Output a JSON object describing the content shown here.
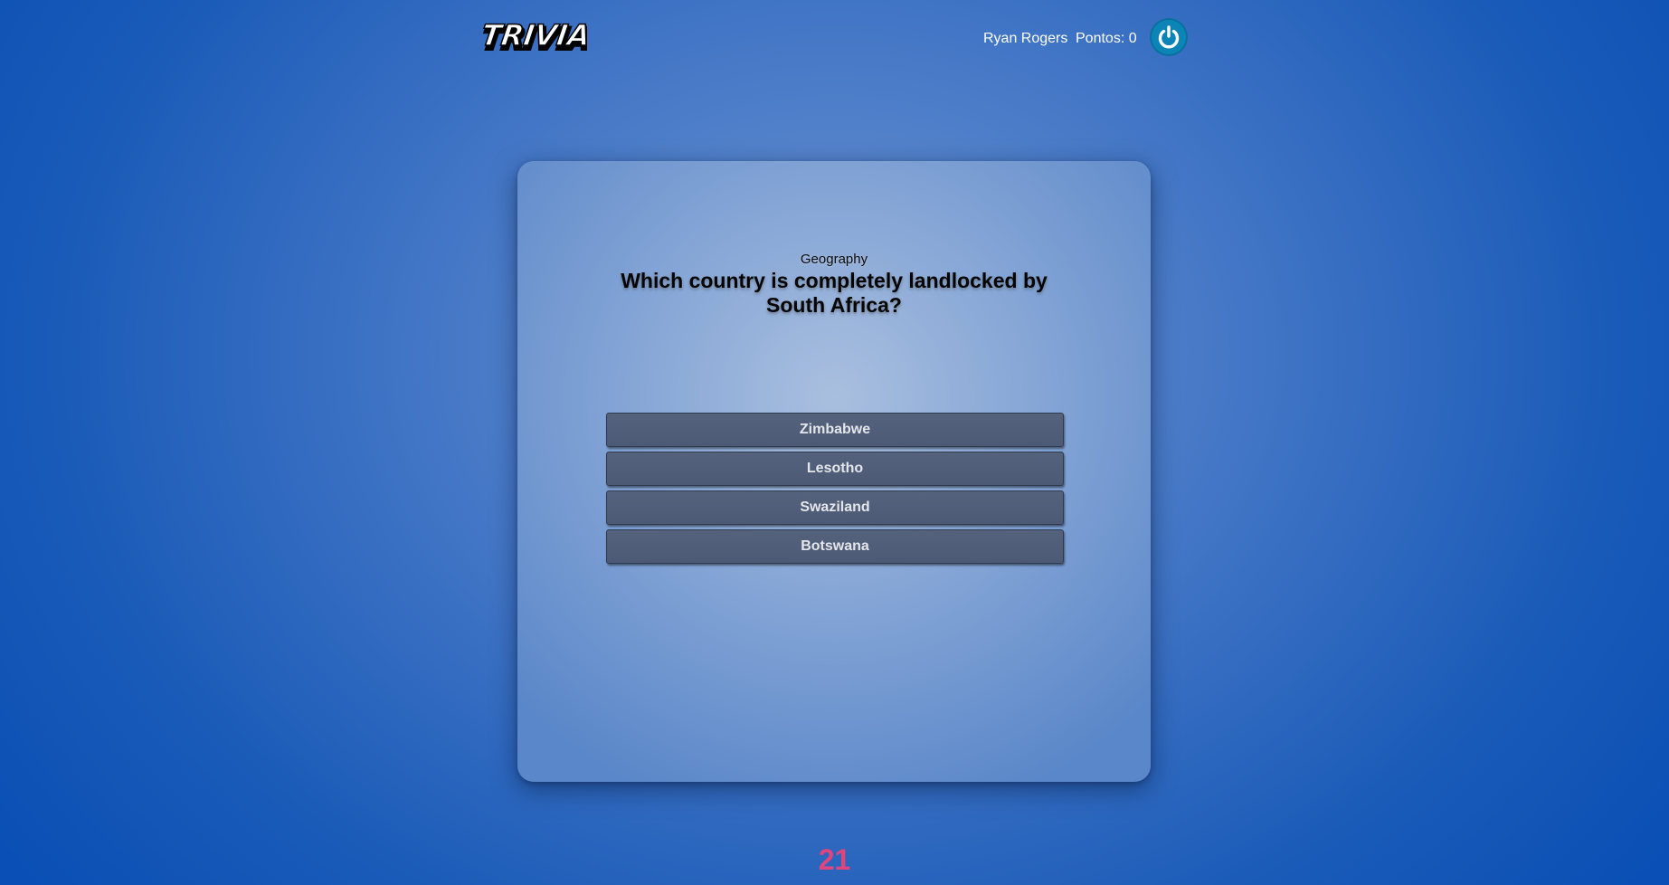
{
  "header": {
    "logo_text": "TRIVIA",
    "user_name": "Ryan Rogers",
    "score_label": "Pontos: 0",
    "logout_icon": "power-icon"
  },
  "game": {
    "category": "Geography",
    "question": "Which country is completely landlocked by South Africa?",
    "answers": [
      {
        "label": "Zimbabwe"
      },
      {
        "label": "Lesotho"
      },
      {
        "label": "Swaziland"
      },
      {
        "label": "Botswana"
      }
    ],
    "timer": "21"
  },
  "colors": {
    "background": "#1a5bb8",
    "card": "#86a6d6",
    "answer_button": "#4f5d79",
    "timer": "#e0457e",
    "power_button": "#0a85b5"
  }
}
